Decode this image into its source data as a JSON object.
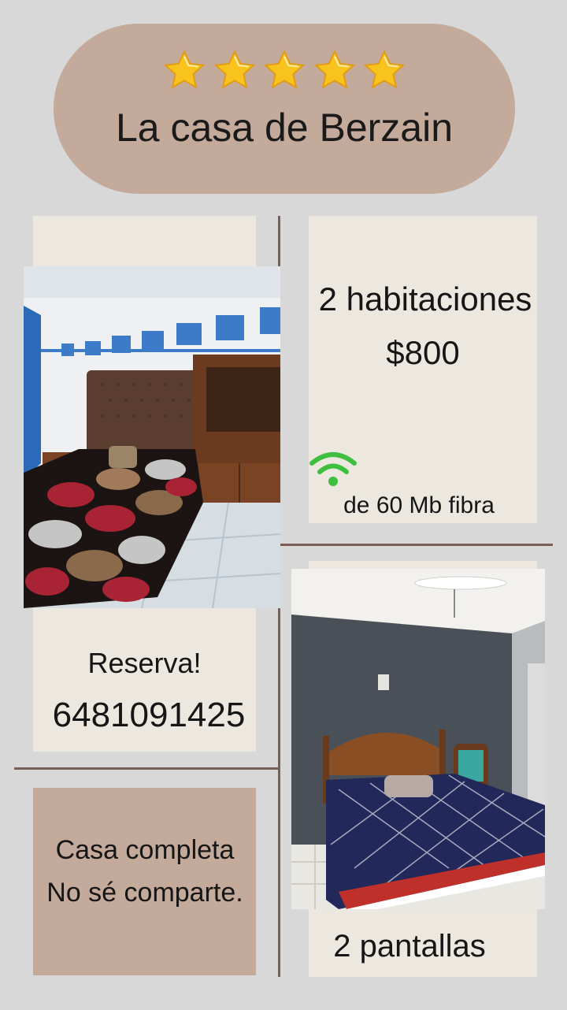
{
  "header": {
    "rating_stars": 5,
    "title": "La casa de Berzain"
  },
  "info": {
    "rooms": "2 habitaciones",
    "price": "$800",
    "wifi_icon": "wifi-icon",
    "internet": "de 60 Mb fibra"
  },
  "booking": {
    "cta": "Reserva!",
    "phone": "6481091425"
  },
  "notice": {
    "line1": "Casa completa",
    "line2": "No sé comparte."
  },
  "amenities": {
    "tvs": "2 pantallas"
  },
  "colors": {
    "background": "#d9d8d8",
    "header_pill": "#c4aa9a",
    "paper": "#ece8e0",
    "notice_box": "#c4aa9a",
    "divider": "#7b5e55",
    "wifi": "#3fbf3f",
    "star": "#f7c31c"
  }
}
